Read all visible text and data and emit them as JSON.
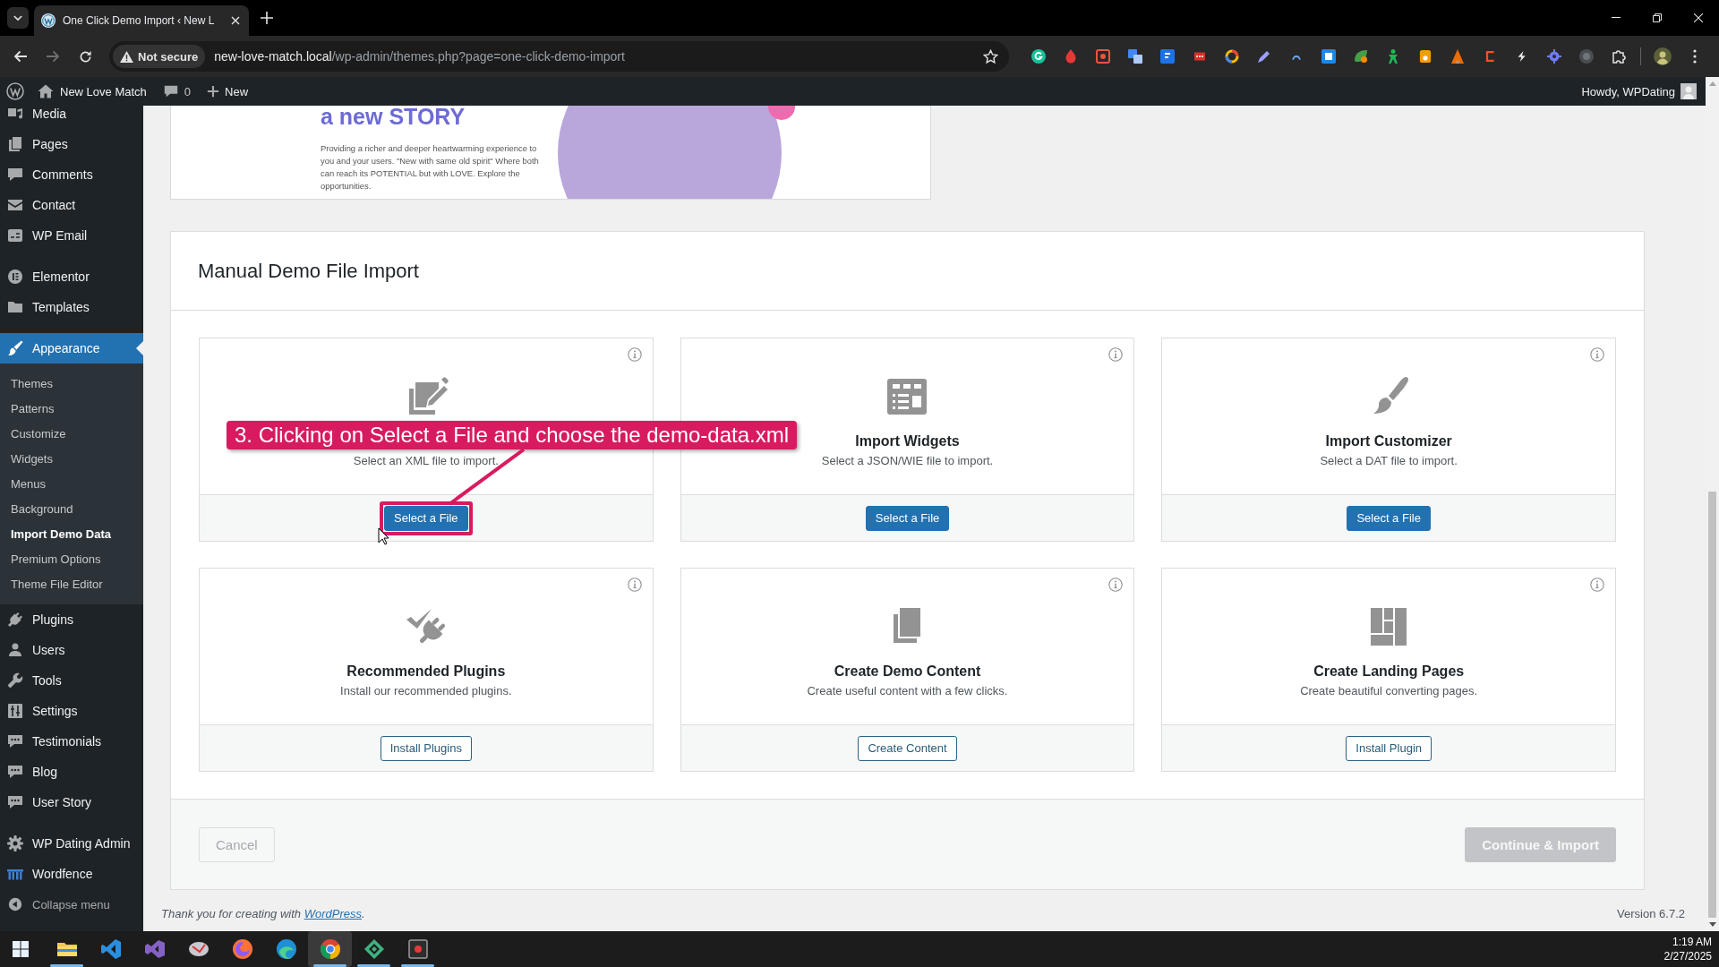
{
  "browser": {
    "tabs": [
      {
        "title": "One Click Demo Import ‹ New L",
        "selected": true
      }
    ],
    "nav": {
      "back_disabled": false,
      "forward_disabled": true
    },
    "security_chip": "Not secure",
    "url": {
      "host": "new-love-match.local",
      "path": "/wp-admin/themes.php?page=one-click-demo-import"
    }
  },
  "admin_bar": {
    "site_name": "New Love Match",
    "comments_count": "0",
    "new_label": "New",
    "greeting": "Howdy, WPDating"
  },
  "sidebar": {
    "groups": [
      {
        "items": [
          {
            "label": "Media",
            "selected": false
          },
          {
            "label": "Pages",
            "selected": false
          },
          {
            "label": "Comments",
            "selected": false
          },
          {
            "label": "Contact",
            "selected": false
          },
          {
            "label": "WP Email",
            "selected": false
          }
        ]
      },
      {
        "items": [
          {
            "label": "Elementor",
            "selected": false
          },
          {
            "label": "Templates",
            "selected": false
          }
        ]
      },
      {
        "items": [
          {
            "label": "Appearance",
            "selected": true,
            "children": [
              {
                "label": "Themes",
                "selected": false
              },
              {
                "label": "Patterns",
                "selected": false
              },
              {
                "label": "Customize",
                "selected": false
              },
              {
                "label": "Widgets",
                "selected": false
              },
              {
                "label": "Menus",
                "selected": false
              },
              {
                "label": "Background",
                "selected": false
              },
              {
                "label": "Import Demo Data",
                "selected": true
              },
              {
                "label": "Premium Options",
                "selected": false
              },
              {
                "label": "Theme File Editor",
                "selected": false
              }
            ]
          },
          {
            "label": "Plugins",
            "selected": false
          },
          {
            "label": "Users",
            "selected": false
          },
          {
            "label": "Tools",
            "selected": false
          },
          {
            "label": "Settings",
            "selected": false
          },
          {
            "label": "Testimonials",
            "selected": false
          },
          {
            "label": "Blog",
            "selected": false
          },
          {
            "label": "User Story",
            "selected": false
          }
        ]
      },
      {
        "items": [
          {
            "label": "WP Dating Admin",
            "selected": false
          },
          {
            "label": "Wordfence",
            "selected": false
          }
        ]
      }
    ],
    "collapse_label": "Collapse menu"
  },
  "banner": {
    "heading": "a new STORY",
    "text": "Providing a richer and deeper heartwarming experience to you and your users. \"New with same old spirit\" Where both can reach its POTENTIAL but with LOVE. Explore the opportunities."
  },
  "import_panel": {
    "title": "Manual Demo File Import",
    "cards": [
      {
        "description": "Select an XML file to import.",
        "button": {
          "label": "Select a File",
          "kind": "primary",
          "highlighted": true
        }
      },
      {
        "title": "Import Widgets",
        "description": "Select a JSON/WIE file to import.",
        "button": {
          "label": "Select a File",
          "kind": "primary",
          "highlighted": false
        }
      },
      {
        "title": "Import Customizer",
        "description": "Select a DAT file to import.",
        "button": {
          "label": "Select a File",
          "kind": "primary",
          "highlighted": false
        }
      },
      {
        "title": "Recommended Plugins",
        "description": "Install our recommended plugins.",
        "button": {
          "label": "Install Plugins",
          "kind": "secondary",
          "highlighted": false
        }
      },
      {
        "title": "Create Demo Content",
        "description": "Create useful content with a few clicks.",
        "button": {
          "label": "Create Content",
          "kind": "secondary",
          "highlighted": false
        }
      },
      {
        "title": "Create Landing Pages",
        "description": "Create beautiful converting pages.",
        "button": {
          "label": "Install Plugin",
          "kind": "secondary",
          "highlighted": false
        }
      }
    ],
    "cancel": {
      "label": "Cancel",
      "disabled": true
    },
    "continue": {
      "label": "Continue & Import",
      "disabled": true
    }
  },
  "annotation": {
    "text": "3. Clicking on Select a File and choose the demo-data.xml"
  },
  "footer": {
    "text_before": "Thank you for creating with",
    "link": "WordPress",
    "text_after": ".",
    "version": "Version 6.7.2"
  },
  "taskbar": {
    "apps": [
      {
        "running": true,
        "selected": false
      },
      {
        "running": false,
        "selected": false
      },
      {
        "running": false,
        "selected": false
      },
      {
        "running": false,
        "selected": false
      },
      {
        "running": false,
        "selected": false
      },
      {
        "running": false,
        "selected": false
      },
      {
        "running": true,
        "selected": true
      },
      {
        "running": true,
        "selected": false
      },
      {
        "running": true,
        "selected": false
      }
    ],
    "time": "1:19 AM",
    "date": "2/27/2025"
  }
}
